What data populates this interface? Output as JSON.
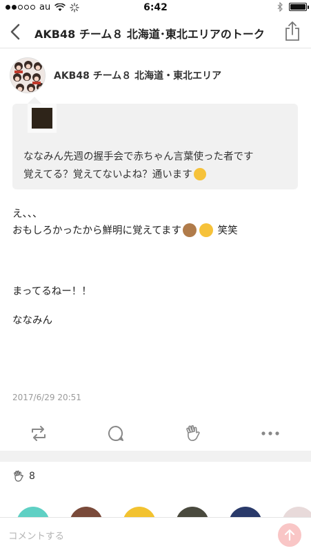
{
  "status_bar": {
    "carrier": "au",
    "time": "6:42",
    "signal_strength": 2,
    "battery_level": 1.0
  },
  "nav": {
    "title": "AKB48 チーム８ 北海道･東北エリアのトーク",
    "back_icon": "chevron-left-icon",
    "share_icon": "share-icon"
  },
  "post": {
    "author": "AKB48 チーム８ 北海道・東北エリア",
    "quote": {
      "line1": "ななみん先週の握手会で赤ちゃん言葉使った者です",
      "line2": "覚えてる？覚えてないよね？通います"
    },
    "body": {
      "line1": "え、、、",
      "line2": "おもしろかったから鮮明に覚えてます",
      "line2_suffix": "笑笑",
      "line3": "まってるねー！！",
      "line4": "ななみん"
    },
    "timestamp": "2017/6/29 20:51"
  },
  "actions": {
    "repost_icon": "repost-icon",
    "comment_icon": "comment-icon",
    "clap_icon": "clap-icon",
    "more_icon": "more-icon"
  },
  "reactions": {
    "count": "8"
  },
  "comment": {
    "placeholder": "コメントする"
  },
  "colors": {
    "send_button": "#f9c6c6",
    "quote_background": "#f1f1f1",
    "separator": "#f1f1f1",
    "timestamp": "#9a9a9a"
  }
}
